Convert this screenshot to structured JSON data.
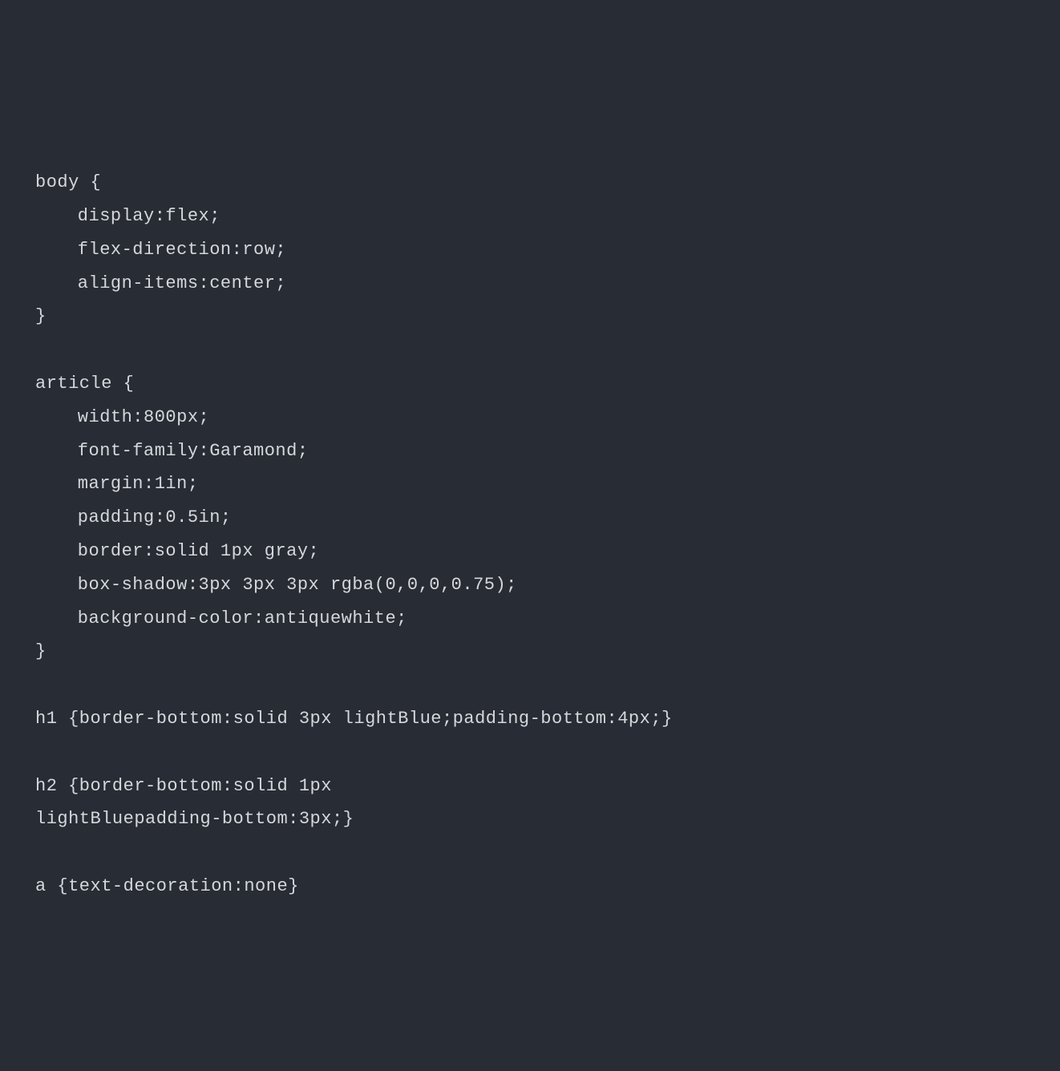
{
  "code": {
    "lines": [
      {
        "text": "body {",
        "indent": false
      },
      {
        "text": "display:flex;",
        "indent": true
      },
      {
        "text": "flex-direction:row;",
        "indent": true
      },
      {
        "text": "align-items:center;",
        "indent": true
      },
      {
        "text": "}",
        "indent": false
      },
      {
        "text": "",
        "indent": false
      },
      {
        "text": "article {",
        "indent": false
      },
      {
        "text": "width:800px;",
        "indent": true
      },
      {
        "text": "font-family:Garamond;",
        "indent": true
      },
      {
        "text": "margin:1in;",
        "indent": true
      },
      {
        "text": "padding:0.5in;",
        "indent": true
      },
      {
        "text": "border:solid 1px gray;",
        "indent": true
      },
      {
        "text": "box-shadow:3px 3px 3px rgba(0,0,0,0.75);",
        "indent": true
      },
      {
        "text": "background-color:antiquewhite;",
        "indent": true
      },
      {
        "text": "}",
        "indent": false
      },
      {
        "text": "",
        "indent": false
      },
      {
        "text": "h1 {border-bottom:solid 3px lightBlue;padding-bottom:4px;}",
        "indent": false
      },
      {
        "text": "",
        "indent": false
      },
      {
        "text": "h2 {border-bottom:solid 1px",
        "indent": false
      },
      {
        "text": "lightBluepadding-bottom:3px;}",
        "indent": false
      },
      {
        "text": "",
        "indent": false
      },
      {
        "text": "a {text-decoration:none}",
        "indent": false
      }
    ]
  },
  "colors": {
    "background": "#282c34",
    "foreground": "#d4d8dc"
  }
}
